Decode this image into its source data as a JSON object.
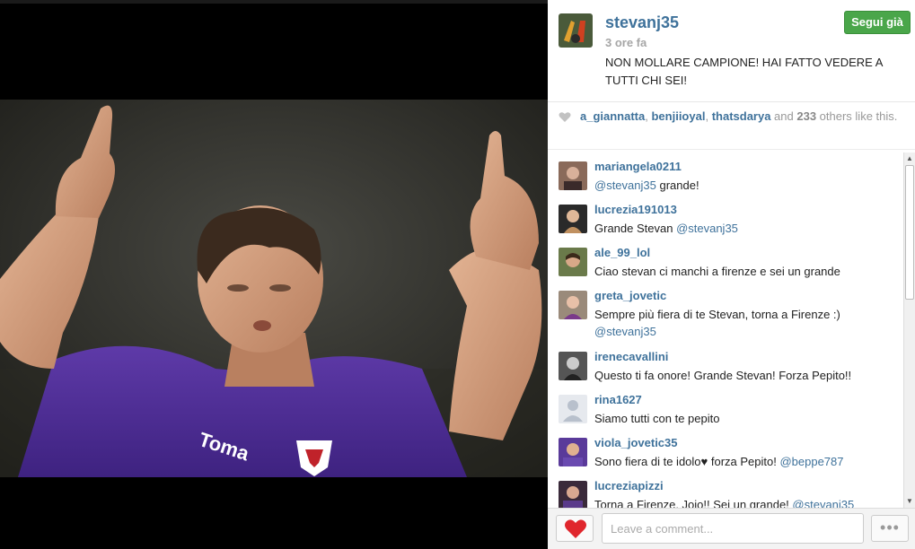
{
  "post": {
    "username": "stevanj35",
    "time": "3 ore fa",
    "caption": "NON MOLLARE CAMPIONE! HAI FATTO VEDERE A TUTTI CHI SEI!",
    "follow_label": "Segui già"
  },
  "photo": {
    "icon": "player-photo",
    "shirt_text": "Toma"
  },
  "likes": {
    "users": [
      "a_giannatta",
      "benjiioyal",
      "thatsdarya"
    ],
    "sep1": ", ",
    "sep2": ", ",
    "and": " and ",
    "count": "233",
    "suffix": " others like this."
  },
  "comments": [
    {
      "user": "mariangela0211",
      "text": "@stevanj35 grande!"
    },
    {
      "user": "lucrezia191013",
      "text": "Grande Stevan @stevanj35"
    },
    {
      "user": "ale_99_lol",
      "text": "Ciao stevan ci manchi a firenze e sei un grande"
    },
    {
      "user": "greta_jovetic",
      "text": "Sempre più fiera di te Stevan, torna a Firenze :) @stevanj35"
    },
    {
      "user": "irenecavallini",
      "text": "Questo ti fa onore! Grande Stevan! Forza Pepito!!"
    },
    {
      "user": "rina1627",
      "text": "Siamo tutti con te pepito"
    },
    {
      "user": "viola_jovetic35",
      "text": "Sono fiera di te idolo♥ forza Pepito! @beppe787"
    },
    {
      "user": "lucreziapizzi",
      "text": "Torna a Firenze, Jojo!! Sei un grande! @stevanj35"
    }
  ],
  "footer": {
    "comment_placeholder": "Leave a comment...",
    "more_label": "•••"
  },
  "colors": {
    "link": "#3f729b",
    "follow_green": "#4aa64a",
    "like_heart": "#e0262d"
  }
}
